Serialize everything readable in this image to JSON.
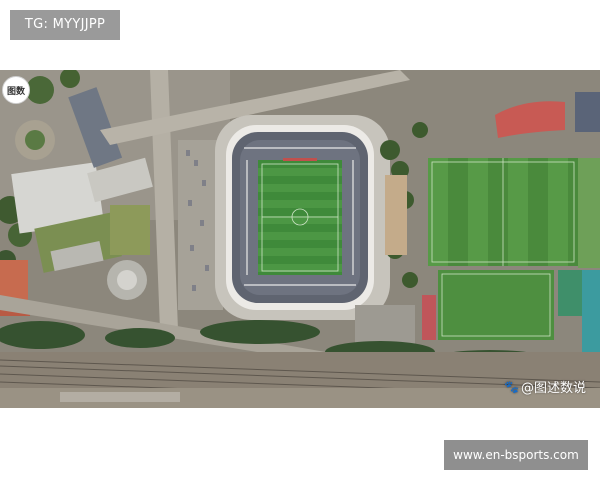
{
  "overlay": {
    "top_left_label": "TG: MYYJJPP",
    "bottom_right_label": "www.en-bsports.com"
  },
  "photo": {
    "corner_logo_text": "图数",
    "watermark_text": "@图述数说",
    "watermark_icon": "paw-icon",
    "subject": "aerial-stadium-view"
  },
  "colors": {
    "label_bg": "#9a9a9a",
    "pitch_green": "#3f8a3a",
    "running_track_red": "#c85a54",
    "rooftop_gray": "#5f6470"
  }
}
